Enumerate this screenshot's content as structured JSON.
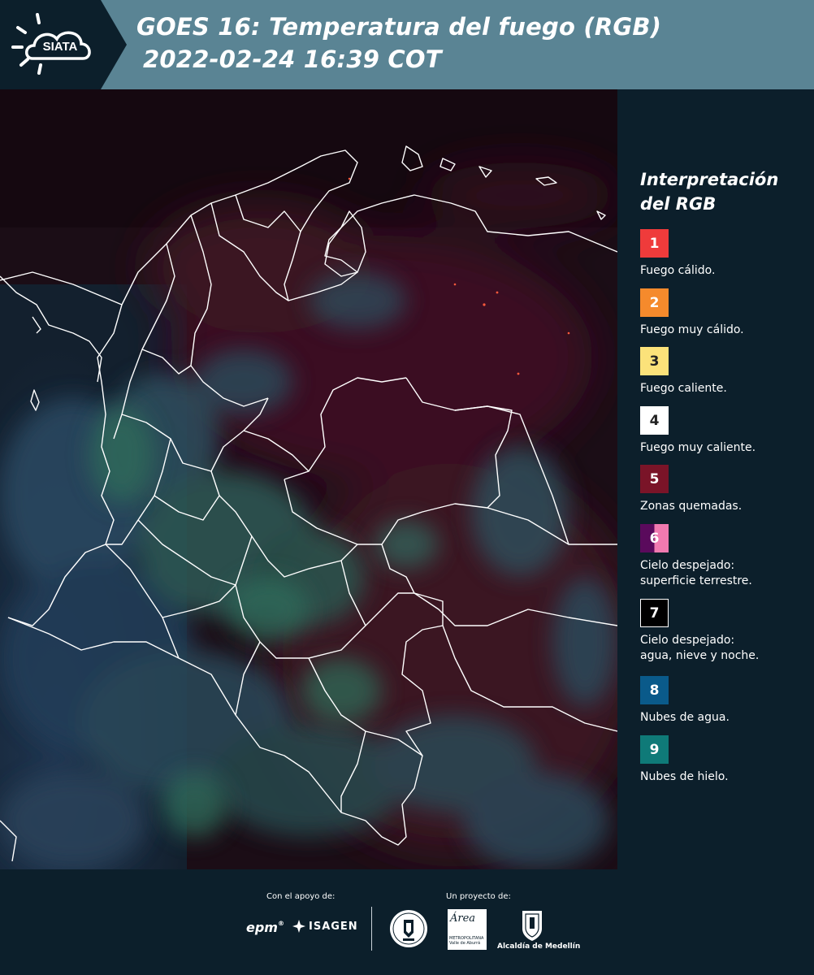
{
  "header": {
    "logo_text": "SIATA",
    "title_line1": "GOES 16: Temperatura del fuego (RGB)",
    "title_line2": "2022-02-24 16:39 COT",
    "band_color": "#5a8494",
    "logo_bg_color": "#0c1f2b"
  },
  "map": {
    "description_icon": "satellite-map",
    "fire_dot_color": "#ff5a3c"
  },
  "legend": {
    "title": "Interpretación del RGB",
    "items": [
      {
        "number": "1",
        "label": "Fuego cálido.",
        "color": "#ef3b3b"
      },
      {
        "number": "2",
        "label": "Fuego muy cálido.",
        "color": "#f58a2c"
      },
      {
        "number": "3",
        "label": "Fuego caliente.",
        "color": "#fbe27a"
      },
      {
        "number": "4",
        "label": "Fuego muy caliente.",
        "color": "#ffffff"
      },
      {
        "number": "5",
        "label": "Zonas quemadas.",
        "color": "#7a1428"
      },
      {
        "number": "6",
        "label_line1": "Cielo despejado:",
        "label_line2": "superficie terrestre.",
        "color_left": "#5a0a5c",
        "color_right": "#f07ab0"
      },
      {
        "number": "7",
        "label_line1": "Cielo despejado:",
        "label_line2": "agua, nieve y noche.",
        "color": "#000000"
      },
      {
        "number": "8",
        "label": "Nubes de agua.",
        "color": "#0a5a8a"
      },
      {
        "number": "9",
        "label": "Nubes de hielo.",
        "color": "#0f7a78"
      }
    ]
  },
  "footer": {
    "support_caption": "Con el apoyo de:",
    "project_caption": "Un proyecto de:",
    "epm": "epm",
    "isagen": "ISAGEN",
    "area_text": "Área",
    "area_sub_line1": "METROPOLITANA",
    "area_sub_line2": "Valle de Aburrá",
    "alcaldia": "Alcaldía de Medellín"
  }
}
